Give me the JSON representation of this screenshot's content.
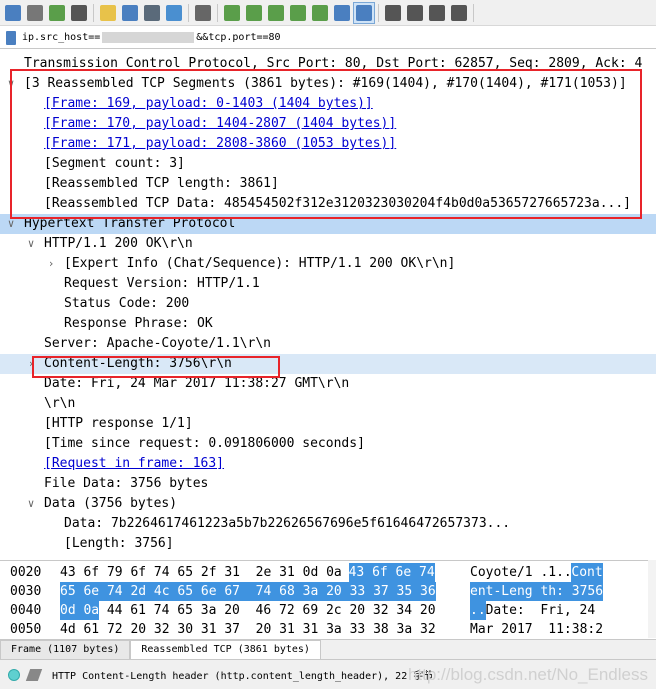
{
  "toolbar": {
    "buttons": [
      {
        "icon": "shark-fin-icon",
        "color": "#4a7fc0"
      },
      {
        "icon": "stop-icon",
        "color": "#777777"
      },
      {
        "icon": "restart-icon",
        "color": "#5a9e4a"
      },
      {
        "icon": "options-icon",
        "color": "#555555"
      },
      {
        "icon": "open-folder-icon",
        "color": "#e8c24a"
      },
      {
        "icon": "save-icon",
        "color": "#4a7fc0"
      },
      {
        "icon": "close-file-icon",
        "color": "#5a6a7a"
      },
      {
        "icon": "reload-icon",
        "color": "#4a8fd0"
      },
      {
        "icon": "find-icon",
        "color": "#666666"
      },
      {
        "icon": "go-back-icon",
        "color": "#5a9e4a"
      },
      {
        "icon": "go-forward-icon",
        "color": "#5a9e4a"
      },
      {
        "icon": "go-to-packet-icon",
        "color": "#5a9e4a"
      },
      {
        "icon": "first-packet-icon",
        "color": "#5a9e4a"
      },
      {
        "icon": "last-packet-icon",
        "color": "#5a9e4a"
      },
      {
        "icon": "autoscroll-icon",
        "color": "#4a7fc0"
      },
      {
        "icon": "colorize-icon",
        "color": "#4a7fc0"
      },
      {
        "icon": "zoom-in-icon",
        "color": "#555555"
      },
      {
        "icon": "zoom-out-icon",
        "color": "#555555"
      },
      {
        "icon": "normal-size-icon",
        "color": "#555555"
      },
      {
        "icon": "resize-columns-icon",
        "color": "#555555"
      }
    ]
  },
  "filter": {
    "prefix": "ip.src_host==",
    "suffix": "&&tcp.port==80"
  },
  "tree": {
    "rows": [
      {
        "text": "Transmission Control Protocol, Src Port: 80, Dst Port: 62857, Seq: 2809, Ack: 4",
        "level": 0,
        "arrow": "",
        "link": false
      },
      {
        "text": "[3 Reassembled TCP Segments (3861 bytes): #169(1404), #170(1404), #171(1053)]",
        "level": 0,
        "arrow": "v",
        "link": false
      },
      {
        "text": "[Frame: 169, payload: 0-1403 (1404 bytes)]",
        "level": 1,
        "arrow": "",
        "link": true
      },
      {
        "text": "[Frame: 170, payload: 1404-2807 (1404 bytes)]",
        "level": 1,
        "arrow": "",
        "link": true
      },
      {
        "text": "[Frame: 171, payload: 2808-3860 (1053 bytes)]",
        "level": 1,
        "arrow": "",
        "link": true
      },
      {
        "text": "[Segment count: 3]",
        "level": 1,
        "arrow": "",
        "link": false
      },
      {
        "text": "[Reassembled TCP length: 3861]",
        "level": 1,
        "arrow": "",
        "link": false
      },
      {
        "text": "[Reassembled TCP Data: 485454502f312e3120323030204f4b0d0a5365727665723a...]",
        "level": 1,
        "arrow": "",
        "link": false
      },
      {
        "text": "Hypertext Transfer Protocol",
        "level": 0,
        "arrow": "v",
        "link": false
      },
      {
        "text": "HTTP/1.1 200 OK\\r\\n",
        "level": 1,
        "arrow": "v",
        "link": false
      },
      {
        "text": "[Expert Info (Chat/Sequence): HTTP/1.1 200 OK\\r\\n]",
        "level": 2,
        "arrow": ">",
        "link": false
      },
      {
        "text": "Request Version: HTTP/1.1",
        "level": 2,
        "arrow": "",
        "link": false
      },
      {
        "text": "Status Code: 200",
        "level": 2,
        "arrow": "",
        "link": false
      },
      {
        "text": "Response Phrase: OK",
        "level": 2,
        "arrow": "",
        "link": false
      },
      {
        "text": "Server: Apache-Coyote/1.1\\r\\n",
        "level": 1,
        "arrow": "",
        "link": false
      },
      {
        "text": "Content-Length: 3756\\r\\n",
        "level": 1,
        "arrow": ">",
        "link": false
      },
      {
        "text": "Date: Fri, 24 Mar 2017 11:38:27 GMT\\r\\n",
        "level": 1,
        "arrow": "",
        "link": false
      },
      {
        "text": "\\r\\n",
        "level": 1,
        "arrow": "",
        "link": false
      },
      {
        "text": "[HTTP response 1/1]",
        "level": 1,
        "arrow": "",
        "link": false
      },
      {
        "text": "[Time since request: 0.091806000 seconds]",
        "level": 1,
        "arrow": "",
        "link": false
      },
      {
        "text": "[Request in frame: 163]",
        "level": 1,
        "arrow": "",
        "link": true
      },
      {
        "text": "File Data: 3756 bytes",
        "level": 1,
        "arrow": "",
        "link": false
      },
      {
        "text": "Data (3756 bytes)",
        "level": 1,
        "arrow": "v",
        "link": false
      },
      {
        "text": "Data: 7b2264617461223a5b7b22626567696e5f61646472657373...",
        "level": 2,
        "arrow": "",
        "link": false
      },
      {
        "text": "[Length: 3756]",
        "level": 2,
        "arrow": "",
        "link": false
      }
    ]
  },
  "hex": {
    "rows": [
      {
        "offset": "0020",
        "hex_a": "43 6f 79 6f 74 65 2f 31  2e 31 0d 0a ",
        "hex_b": "43 6f 6e 74",
        "ascii_a": "Coyote/1 .1..",
        "ascii_b": "Cont"
      },
      {
        "offset": "0030",
        "hex_a": "",
        "hex_b": "65 6e 74 2d 4c 65 6e 67  74 68 3a 20 33 37 35 36",
        "ascii_a": "",
        "ascii_b": "ent-Leng th: 3756"
      },
      {
        "offset": "0040",
        "hex_a": "",
        "hex_b": "0d 0a",
        "hex_c": " 44 61 74 65 3a 20  46 72 69 2c 20 32 34 20",
        "ascii_a": "",
        "ascii_b": "..",
        "ascii_c": "Date:  Fri, 24"
      },
      {
        "offset": "0050",
        "hex_a": "4d 61 72 20 32 30 31 37  20 31 31 3a 33 38 3a 32",
        "hex_b": "",
        "ascii_a": "Mar 2017  11:38:2",
        "ascii_b": ""
      }
    ]
  },
  "tabs": [
    {
      "label": "Frame (1107 bytes)",
      "active": false
    },
    {
      "label": "Reassembled TCP (3861 bytes)",
      "active": true
    }
  ],
  "status": {
    "text": "HTTP Content-Length header (http.content_length_header), 22 字节",
    "watermark": "http://blog.csdn.net/No_Endless"
  }
}
